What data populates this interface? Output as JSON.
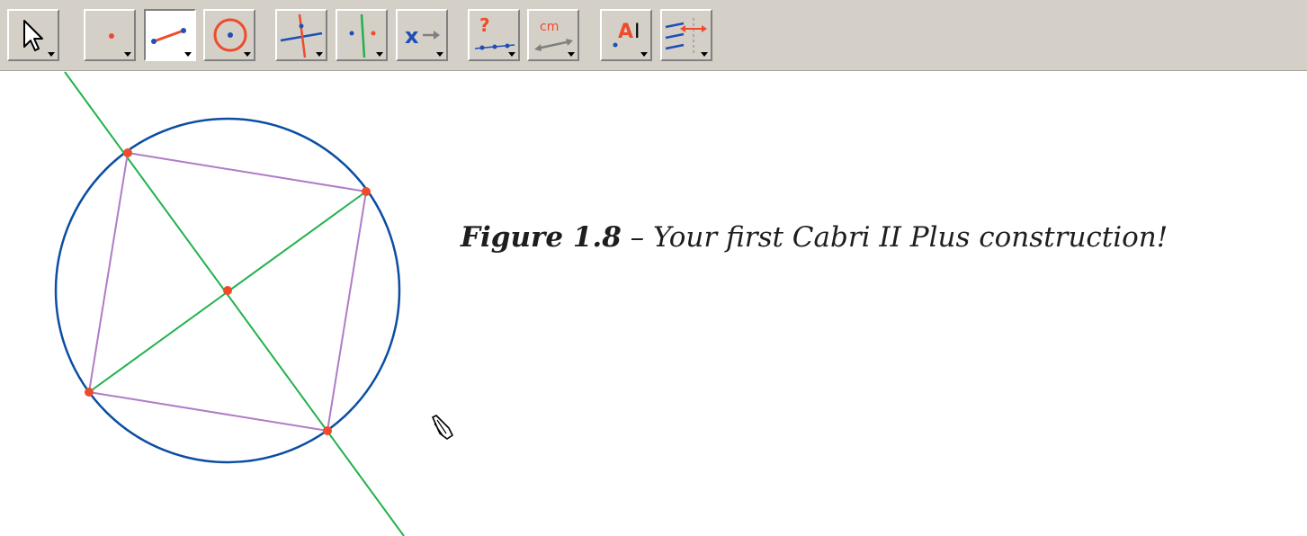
{
  "toolbar": {
    "tools": [
      {
        "name": "pointer",
        "icon": "pointer-arrow-icon"
      },
      {
        "name": "points",
        "icon": "point-icon"
      },
      {
        "name": "lines",
        "icon": "segment-icon",
        "active": true
      },
      {
        "name": "curves",
        "icon": "circle-icon"
      },
      {
        "name": "constructions",
        "icon": "perpendicular-line-icon"
      },
      {
        "name": "transformations",
        "icon": "reflection-icon"
      },
      {
        "name": "macro",
        "icon": "macro-icon"
      },
      {
        "name": "check-property",
        "icon": "check-property-icon"
      },
      {
        "name": "measure",
        "icon": "measure-icon"
      },
      {
        "name": "display",
        "icon": "label-icon"
      },
      {
        "name": "draw",
        "icon": "draw-icon"
      }
    ],
    "glyphs": {
      "question": "?",
      "cm": "cm",
      "label_a": "A",
      "label_cursor": "I",
      "macro_x": "x"
    }
  },
  "construction": {
    "colors": {
      "circle": "#0b4ea2",
      "diameters": "#22b14c",
      "polygon": "#b07cc6",
      "points": "#ee4b2b"
    }
  },
  "caption": {
    "figure_label": "Figure 1.8",
    "dash": " – ",
    "text": "Your first Cabri II Plus construction!"
  }
}
